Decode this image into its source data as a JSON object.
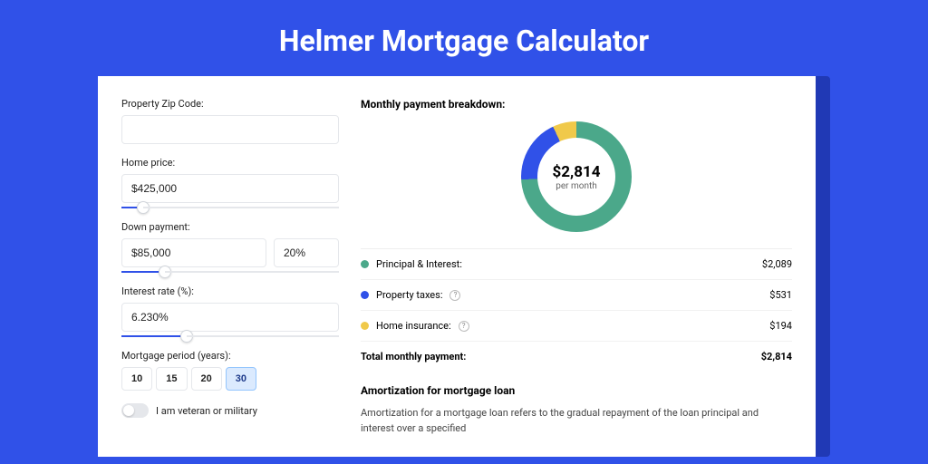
{
  "page": {
    "title": "Helmer Mortgage Calculator"
  },
  "form": {
    "zip": {
      "label": "Property Zip Code:",
      "value": ""
    },
    "homePrice": {
      "label": "Home price:",
      "value": "$425,000",
      "sliderPct": 10
    },
    "downPayment": {
      "label": "Down payment:",
      "value": "$85,000",
      "pct": "20%",
      "sliderPct": 20
    },
    "interest": {
      "label": "Interest rate (%):",
      "value": "6.230%",
      "sliderPct": 30
    },
    "period": {
      "label": "Mortgage period (years):",
      "options": [
        "10",
        "15",
        "20",
        "30"
      ],
      "active": 3
    },
    "veteran": {
      "label": "I am veteran or military",
      "on": false
    }
  },
  "breakdown": {
    "title": "Monthly payment breakdown:",
    "centerValue": "$2,814",
    "centerSub": "per month",
    "items": [
      {
        "label": "Principal & Interest:",
        "value": "$2,089",
        "color": "green",
        "help": false
      },
      {
        "label": "Property taxes:",
        "value": "$531",
        "color": "blue",
        "help": true
      },
      {
        "label": "Home insurance:",
        "value": "$194",
        "color": "yellow",
        "help": true
      }
    ],
    "totalLabel": "Total monthly payment:",
    "totalValue": "$2,814"
  },
  "amort": {
    "title": "Amortization for mortgage loan",
    "body": "Amortization for a mortgage loan refers to the gradual repayment of the loan principal and interest over a specified"
  },
  "chart_data": {
    "type": "pie",
    "title": "Monthly payment breakdown",
    "series": [
      {
        "name": "Principal & Interest",
        "value": 2089,
        "color": "#4ba88a"
      },
      {
        "name": "Property taxes",
        "value": 531,
        "color": "#3051e8"
      },
      {
        "name": "Home insurance",
        "value": 194,
        "color": "#f0c94a"
      }
    ],
    "total": 2814,
    "unit": "USD per month"
  }
}
